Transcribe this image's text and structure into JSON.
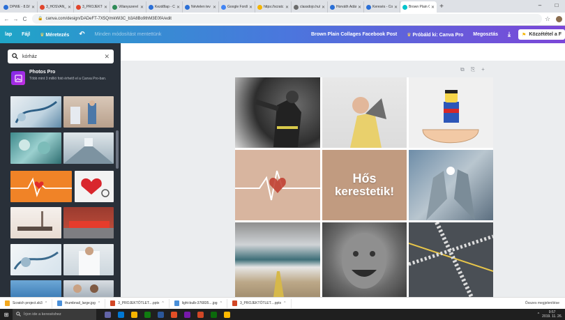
{
  "browser": {
    "tabs": [
      {
        "label": "DPWE - 8.D/c",
        "color": "#2a6fd6"
      },
      {
        "label": "3_HOSVAN_T/",
        "color": "#e0452c"
      },
      {
        "label": "3_PROJEKTÖ",
        "color": "#e0452c"
      },
      {
        "label": "Villanyszerel",
        "color": "#2e8b57"
      },
      {
        "label": "Kezdőlap - Cr",
        "color": "#2a6fd6"
      },
      {
        "label": "Névtelen tev",
        "color": "#2a6fd6"
      },
      {
        "label": "Google Fordít",
        "color": "#4285f4"
      },
      {
        "label": "https://scratc",
        "color": "#f4b400"
      },
      {
        "label": "classdojo.hu/",
        "color": "#6c6c6c"
      },
      {
        "label": "Horváth Ádár",
        "color": "#2a6fd6"
      },
      {
        "label": "Keresés - Cor",
        "color": "#2a6fd6"
      },
      {
        "label": "Brown Plain C",
        "color": "#00c4cc",
        "active": true
      }
    ],
    "new_tab": "+",
    "win_min": "–",
    "win_max": "□",
    "url": "canva.com/design/DADeFT-7X5Q/mkWi3C_b3A8Bo9thM3E0fA/edit",
    "back": "←",
    "forward": "→",
    "reload": "C",
    "lock": "🔒",
    "star": "☆"
  },
  "topbar": {
    "home": "lap",
    "file": "Fájl",
    "resize": "Méretezés",
    "undo": "↶",
    "saved": "Minden módosítást mentettünk",
    "design_title": "Brown Plain Collages Facebook Post",
    "try_pro": "Próbáld ki: Canva Pro",
    "share": "Megosztás",
    "download": "⤓",
    "publish": "Közzététel a F"
  },
  "sidebar": {
    "search_value": "kórház",
    "search_icon": "search-icon",
    "clear": "✕",
    "promo_title": "Photos Pro",
    "promo_text": "Több mint 3 millió fotó érhető el a Canva Pro-ban.",
    "collapse": "‹"
  },
  "canvas": {
    "page_controls": [
      "⧉",
      "⎘",
      "+"
    ],
    "hero_text_line1": "Hős",
    "hero_text_line2": "kerestetik!"
  },
  "downloads": {
    "items": [
      {
        "label": "Scratch project.sb3",
        "color": "#f4a81d"
      },
      {
        "label": "thumbnail_large.jpg",
        "color": "#4a90d9"
      },
      {
        "label": "3_PROJEKTÖTLET....pptx",
        "color": "#d24726"
      },
      {
        "label": "light-bulb-376835....jpg",
        "color": "#4a90d9"
      },
      {
        "label": "3_PROJEKTÖTLET....pptx",
        "color": "#d24726"
      }
    ],
    "caret": "^",
    "show_all": "Összes megjelenítése"
  },
  "taskbar": {
    "start": "⊞",
    "search_placeholder": "Írjon ide a kereséshez",
    "apps": [
      "#6264a7",
      "#0078d4",
      "#f4b400",
      "#107c10",
      "#2b579a",
      "#e34f26",
      "#7719aa",
      "#d24726",
      "#0b6a0b",
      "#ffb900"
    ],
    "time": "9:57",
    "date": "2019. 11. 26."
  }
}
